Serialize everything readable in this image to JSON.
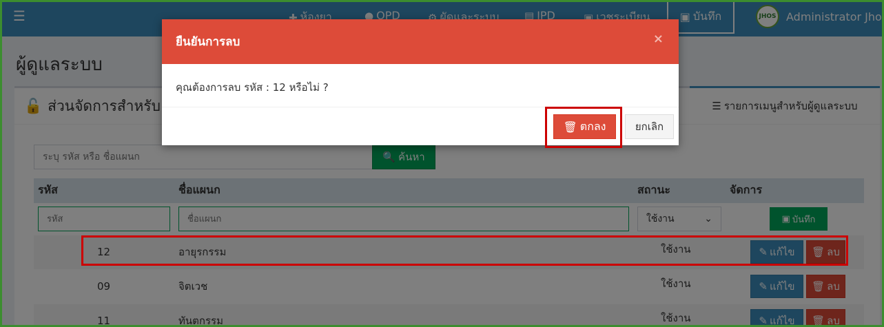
{
  "navbar": {
    "menu_icon": "hamburger-icon",
    "items": [
      {
        "label": "ห้องยา",
        "icon": "medkit-icon"
      },
      {
        "label": "OPD",
        "icon": "users-icon"
      },
      {
        "label": "ผัดและระบบ",
        "icon": "gears-icon"
      },
      {
        "label": "IPD",
        "icon": "bed-icon"
      },
      {
        "label": "เวชระเบียน",
        "icon": "id-card-icon"
      }
    ],
    "save_label": "บันทึก",
    "user_name": "Administrator Jhos",
    "avatar_text": "JHOS"
  },
  "page": {
    "title": "ผู้ดูแลระบบ",
    "section_title": "ส่วนจัดการสำหรับ",
    "tab_menu_label": "รายการเมนูสำหรับผู้ดูแลระบบ"
  },
  "search": {
    "placeholder": "ระบุ รหัส หรือ ชื่อแผนก",
    "button_label": "ค้นหา"
  },
  "table": {
    "headers": {
      "code": "รหัส",
      "name": "ชื่อแผนก",
      "status": "สถานะ",
      "actions": "จัดการ"
    },
    "filter": {
      "code_placeholder": "รหัส",
      "name_placeholder": "ชื่อแผนก",
      "status_selected": "ใช้งาน",
      "save_label": "บันทึก"
    },
    "rows": [
      {
        "code": "12",
        "name": "อายุรกรรม",
        "status": "ใช้งาน"
      },
      {
        "code": "09",
        "name": "จิตเวช",
        "status": "ใช้งาน"
      },
      {
        "code": "11",
        "name": "ทันตกรรม",
        "status": "ใช้งาน"
      }
    ],
    "edit_label": "แก้ไข",
    "delete_label": "ลบ"
  },
  "modal": {
    "title": "ยืนยันการลบ",
    "close": "×",
    "message": "คุณต้องการลบ รหัส : 12 หรือไม่ ?",
    "ok_label": "ตกลง",
    "cancel_label": "ยกเลิก"
  },
  "colors": {
    "navbar": "#3c8dbc",
    "danger": "#dd4b39",
    "success": "#00a65a",
    "highlight": "#cc0000"
  }
}
